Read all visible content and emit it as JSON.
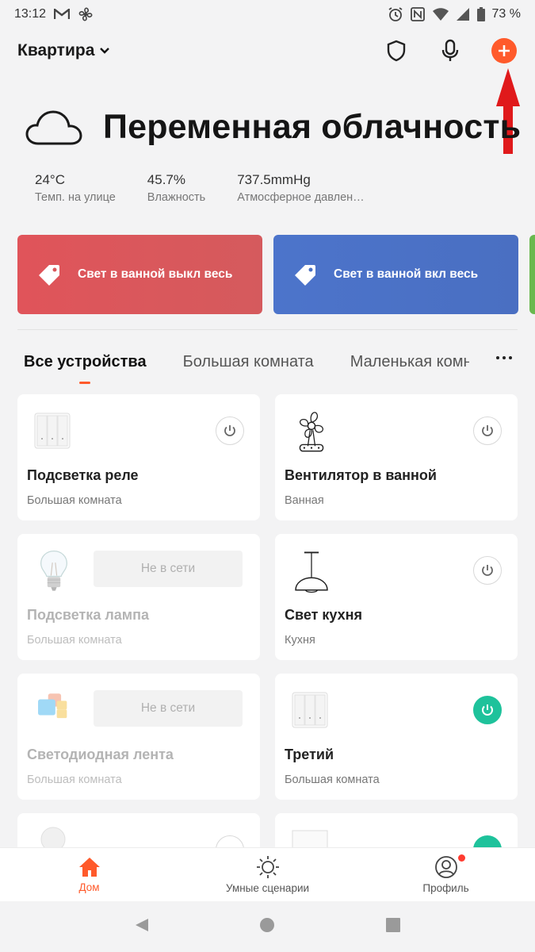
{
  "status_bar": {
    "time": "13:12",
    "left_icons": [
      "gmail-m-icon",
      "fan-icon"
    ],
    "right_icons": [
      "alarm-icon",
      "nfc-icon",
      "wifi-icon",
      "signal-icon",
      "battery-icon"
    ],
    "battery": "73 %"
  },
  "header": {
    "home_name": "Квартира",
    "actions": [
      "shield-icon",
      "microphone-icon",
      "add-icon"
    ]
  },
  "weather": {
    "condition": "Переменная облачность",
    "icon": "cloud-icon",
    "metrics": [
      {
        "value": "24°C",
        "label": "Темп. на улице"
      },
      {
        "value": "45.7%",
        "label": "Влажность"
      },
      {
        "value": "737.5mmHg",
        "label": "Атмосферное давлен…"
      }
    ]
  },
  "scenes": [
    {
      "label": "Свет в ванной выкл весь",
      "color": "#d9585c"
    },
    {
      "label": "Свет в ванной вкл весь",
      "color": "#4a6fc2"
    }
  ],
  "tabs": [
    "Все устройства",
    "Большая комната",
    "Маленькая комн"
  ],
  "devices": [
    {
      "name": "Подсветка реле",
      "room": "Большая комната",
      "icon": "relay-switch-icon"
    },
    {
      "name": "Вентилятор в ванной",
      "room": "Ванная",
      "icon": "fan-sketch-icon"
    },
    {
      "name": "Подсветка лампа",
      "room": "Большая комната",
      "icon": "bulb-icon",
      "status": "Не в сети"
    },
    {
      "name": "Свет кухня",
      "room": "Кухня",
      "icon": "pendant-lamp-icon"
    },
    {
      "name": "Светодиодная лента",
      "room": "Большая комната",
      "icon": "led-strip-icon",
      "status": "Не в сети"
    },
    {
      "name": "Третий",
      "room": "Большая комната",
      "icon": "relay-switch-icon"
    }
  ],
  "bottom_nav": [
    "Дом",
    "Умные сценарии",
    "Профиль"
  ],
  "colors": {
    "accent": "#ff5a2b",
    "power_on": "#1ec29b",
    "annotation_arrow": "#e0191b"
  }
}
